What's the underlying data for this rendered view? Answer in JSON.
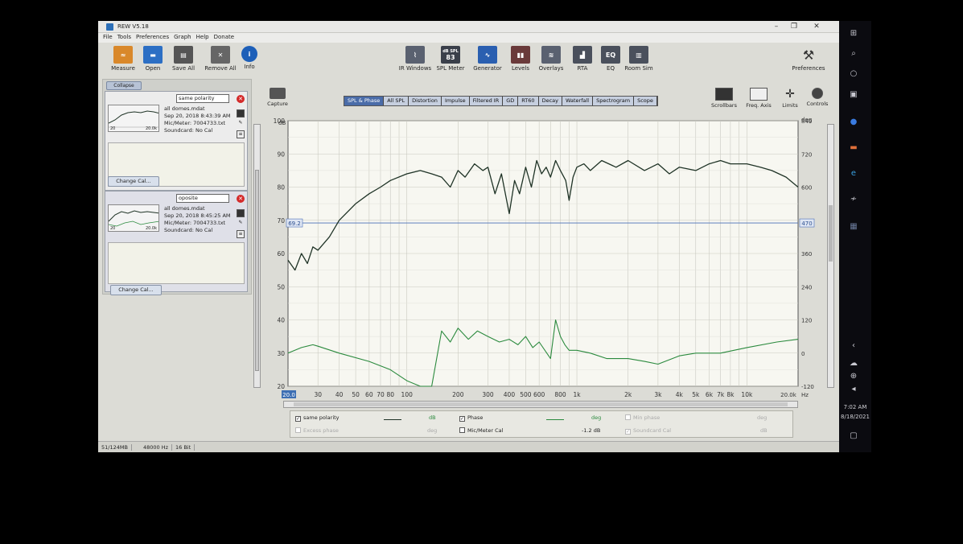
{
  "window": {
    "title": "REW V5.18"
  },
  "menu": [
    "File",
    "Tools",
    "Preferences",
    "Graph",
    "Help",
    "Donate"
  ],
  "toolbar_left": [
    {
      "label": "Measure",
      "icon": "measure-icon"
    },
    {
      "label": "Open",
      "icon": "folder-icon"
    },
    {
      "label": "Save All",
      "icon": "save-icon"
    },
    {
      "label": "Remove All",
      "icon": "remove-icon"
    },
    {
      "label": "Info",
      "icon": "info-icon"
    }
  ],
  "toolbar_center": [
    {
      "label": "IR Windows",
      "icon": "ir-windows-icon"
    },
    {
      "label": "SPL Meter",
      "icon": "spl-meter-icon",
      "display": "83",
      "display_top": "dB SPL"
    },
    {
      "label": "Generator",
      "icon": "generator-icon"
    },
    {
      "label": "Levels",
      "icon": "levels-icon"
    },
    {
      "label": "Overlays",
      "icon": "overlays-icon"
    },
    {
      "label": "RTA",
      "icon": "rta-icon"
    },
    {
      "label": "EQ",
      "icon": "eq-icon"
    },
    {
      "label": "Room Sim",
      "icon": "room-sim-icon"
    }
  ],
  "toolbar_right": {
    "label": "Preferences",
    "icon": "wrench-icon"
  },
  "panel": {
    "collapse_label": "Collapse",
    "measurements": [
      {
        "name": "same polarity",
        "file": "all domes.mdat",
        "date": "Sep 20, 2018 8:43:39 AM",
        "mic": "Mic/Meter: 7004733.txt",
        "soundcard": "Soundcard: No Cal",
        "thumb_lo": "20",
        "thumb_hi": "20.0k"
      },
      {
        "name": "oposite",
        "file": "all domes.mdat",
        "date": "Sep 20, 2018 8:45:25 AM",
        "mic": "Mic/Meter: 7004733.txt",
        "soundcard": "Soundcard: No Cal",
        "thumb_lo": "20",
        "thumb_hi": "20.0k"
      }
    ],
    "change_cal_label": "Change Cal..."
  },
  "capture_label": "Capture",
  "graph_tabs": [
    "SPL & Phase",
    "All SPL",
    "Distortion",
    "Impulse",
    "Filtered IR",
    "GD",
    "RT60",
    "Decay",
    "Waterfall",
    "Spectrogram",
    "Scope"
  ],
  "active_tab": "SPL & Phase",
  "right_tools": [
    {
      "label": "Scrollbars",
      "icon": "scrollbars-icon"
    },
    {
      "label": "Freq. Axis",
      "icon": "freq-axis-icon"
    },
    {
      "label": "Limits",
      "icon": "limits-icon"
    },
    {
      "label": "Controls",
      "icon": "controls-icon"
    }
  ],
  "chart_data": {
    "type": "line",
    "xscale": "log",
    "xlim": [
      20,
      20000
    ],
    "ylim": [
      20,
      100
    ],
    "y2lim": [
      -120,
      840
    ],
    "ylabel": "dB",
    "y2label": "deg",
    "xunit": "Hz",
    "x_start_label": "20.0",
    "x_end_label": "20.0k",
    "xticks": [
      {
        "v": 30,
        "t": "30"
      },
      {
        "v": 40,
        "t": "40"
      },
      {
        "v": 50,
        "t": "50"
      },
      {
        "v": 60,
        "t": "60"
      },
      {
        "v": 70,
        "t": "70"
      },
      {
        "v": 80,
        "t": "80"
      },
      {
        "v": 100,
        "t": "100"
      },
      {
        "v": 200,
        "t": "200"
      },
      {
        "v": 300,
        "t": "300"
      },
      {
        "v": 400,
        "t": "400"
      },
      {
        "v": 500,
        "t": "500"
      },
      {
        "v": 600,
        "t": "600"
      },
      {
        "v": 800,
        "t": "800"
      },
      {
        "v": 1000,
        "t": "1k"
      },
      {
        "v": 2000,
        "t": "2k"
      },
      {
        "v": 3000,
        "t": "3k"
      },
      {
        "v": 4000,
        "t": "4k"
      },
      {
        "v": 5000,
        "t": "5k"
      },
      {
        "v": 6000,
        "t": "6k"
      },
      {
        "v": 7000,
        "t": "7k"
      },
      {
        "v": 8000,
        "t": "8k"
      },
      {
        "v": 10000,
        "t": "10k"
      }
    ],
    "yticks": [
      20,
      30,
      40,
      50,
      60,
      70,
      80,
      90,
      100
    ],
    "y2ticks": [
      -120,
      0,
      120,
      240,
      360,
      470,
      600,
      720,
      840
    ],
    "cursor": {
      "y": 69.2,
      "label": "69.2",
      "y2_label": "470"
    },
    "series": [
      {
        "name": "same polarity",
        "axis": "y",
        "color": "#1f3326",
        "x": [
          20,
          22,
          24,
          26,
          28,
          30,
          35,
          40,
          50,
          60,
          70,
          80,
          100,
          120,
          140,
          160,
          180,
          200,
          220,
          250,
          280,
          300,
          330,
          360,
          400,
          430,
          460,
          500,
          540,
          580,
          620,
          660,
          700,
          750,
          800,
          860,
          900,
          950,
          1000,
          1100,
          1200,
          1400,
          1700,
          2000,
          2500,
          3000,
          3500,
          4000,
          5000,
          6000,
          7000,
          8000,
          10000,
          12000,
          14000,
          17000,
          20000
        ],
        "y": [
          58,
          55,
          60,
          57,
          62,
          61,
          65,
          70,
          75,
          78,
          80,
          82,
          84,
          85,
          84,
          83,
          80,
          85,
          83,
          87,
          85,
          86,
          78,
          84,
          72,
          82,
          78,
          86,
          80,
          88,
          84,
          86,
          83,
          88,
          85,
          82,
          76,
          83,
          86,
          87,
          85,
          88,
          86,
          88,
          85,
          87,
          84,
          86,
          85,
          87,
          88,
          87,
          87,
          86,
          85,
          83,
          80
        ]
      },
      {
        "name": "Phase",
        "axis": "y2",
        "color": "#2b8a3e",
        "x": [
          20,
          24,
          28,
          30,
          40,
          60,
          80,
          100,
          120,
          140,
          160,
          180,
          200,
          230,
          260,
          300,
          350,
          400,
          450,
          500,
          550,
          600,
          700,
          750,
          800,
          850,
          900,
          1000,
          1200,
          1500,
          2000,
          2500,
          3000,
          4000,
          5000,
          7000,
          10000,
          15000,
          20000
        ],
        "y": [
          0,
          20,
          30,
          25,
          0,
          -30,
          -60,
          -100,
          -130,
          -130,
          80,
          40,
          90,
          50,
          80,
          60,
          40,
          50,
          30,
          60,
          20,
          40,
          -20,
          120,
          60,
          30,
          10,
          10,
          0,
          -20,
          -20,
          -30,
          -40,
          -10,
          0,
          0,
          20,
          40,
          50
        ]
      }
    ]
  },
  "legend": {
    "row1": [
      {
        "label": "same polarity",
        "unit": "dB",
        "checked": true,
        "enabled": true
      },
      {
        "label": "Phase",
        "unit": "deg",
        "checked": true,
        "enabled": true
      },
      {
        "label": "Min phase",
        "unit": "deg",
        "checked": false,
        "enabled": false
      }
    ],
    "row2": [
      {
        "label": "Excess phase",
        "unit": "deg",
        "checked": false,
        "enabled": false
      },
      {
        "label": "Mic/Meter Cal",
        "unit": "",
        "value": "-1.2 dB",
        "checked": false,
        "enabled": true
      },
      {
        "label": "Soundcard Cal",
        "unit": "dB",
        "checked": true,
        "enabled": false
      }
    ]
  },
  "status": {
    "memory": "51/124MB",
    "rate": "48000 Hz",
    "bits": "16 Bit"
  },
  "taskbar": {
    "time": "7:02 AM",
    "date": "8/18/2021"
  }
}
